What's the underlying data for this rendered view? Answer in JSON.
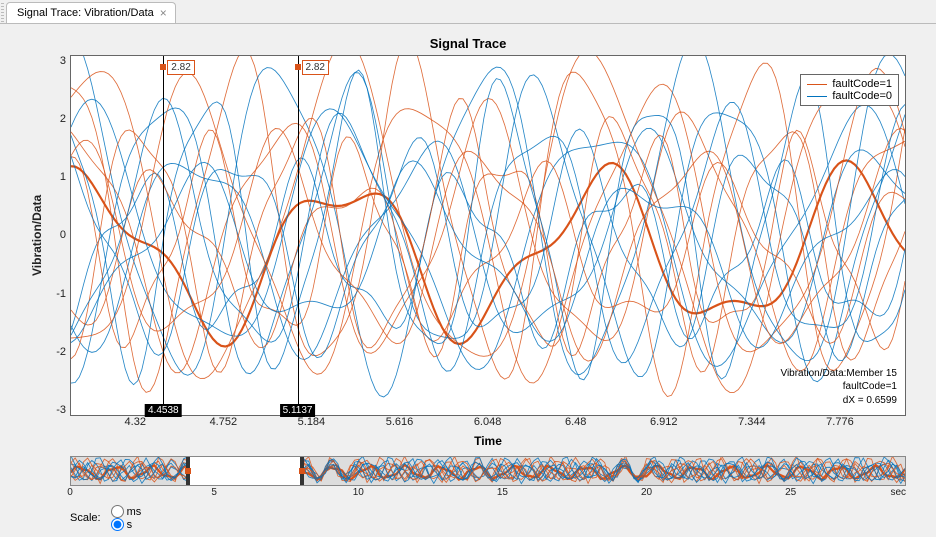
{
  "tab": {
    "title": "Signal Trace: Vibration/Data",
    "close_glyph": "×"
  },
  "chart_data": {
    "type": "line",
    "title": "Signal Trace",
    "xlabel": "Time",
    "ylabel": "Vibration/Data",
    "xlim": [
      4.0,
      8.1
    ],
    "ylim": [
      -3,
      3
    ],
    "yticks": [
      "3",
      "2",
      "1",
      "0",
      "-1",
      "-2",
      "-3"
    ],
    "xticks": [
      4.32,
      4.752,
      5.184,
      5.616,
      6.048,
      6.48,
      6.912,
      7.344,
      7.776
    ],
    "series": [
      {
        "name": "faultCode=1",
        "color": "#d95319"
      },
      {
        "name": "faultCode=0",
        "color": "#0072bd"
      }
    ],
    "cursors": [
      {
        "x": 4.4538,
        "peak_y": 2.82
      },
      {
        "x": 5.1137,
        "peak_y": 2.82
      }
    ],
    "legend": {
      "entries": [
        {
          "label": "faultCode=1",
          "color_key": "orange"
        },
        {
          "label": "faultCode=0",
          "color_key": "blue"
        }
      ]
    },
    "info": {
      "member": "Vibration/Data:Member 15",
      "code": "faultCode=1",
      "dx": "dX = 0.6599"
    }
  },
  "panner": {
    "xlim": [
      0,
      29
    ],
    "ticks": [
      0,
      5,
      10,
      15,
      20,
      25
    ],
    "window": {
      "start": 4.0,
      "end": 8.1
    },
    "unit": "sec"
  },
  "scale": {
    "label": "Scale:",
    "options": [
      {
        "value": "ms",
        "label": "ms",
        "checked": false
      },
      {
        "value": "s",
        "label": "s",
        "checked": true
      }
    ]
  }
}
